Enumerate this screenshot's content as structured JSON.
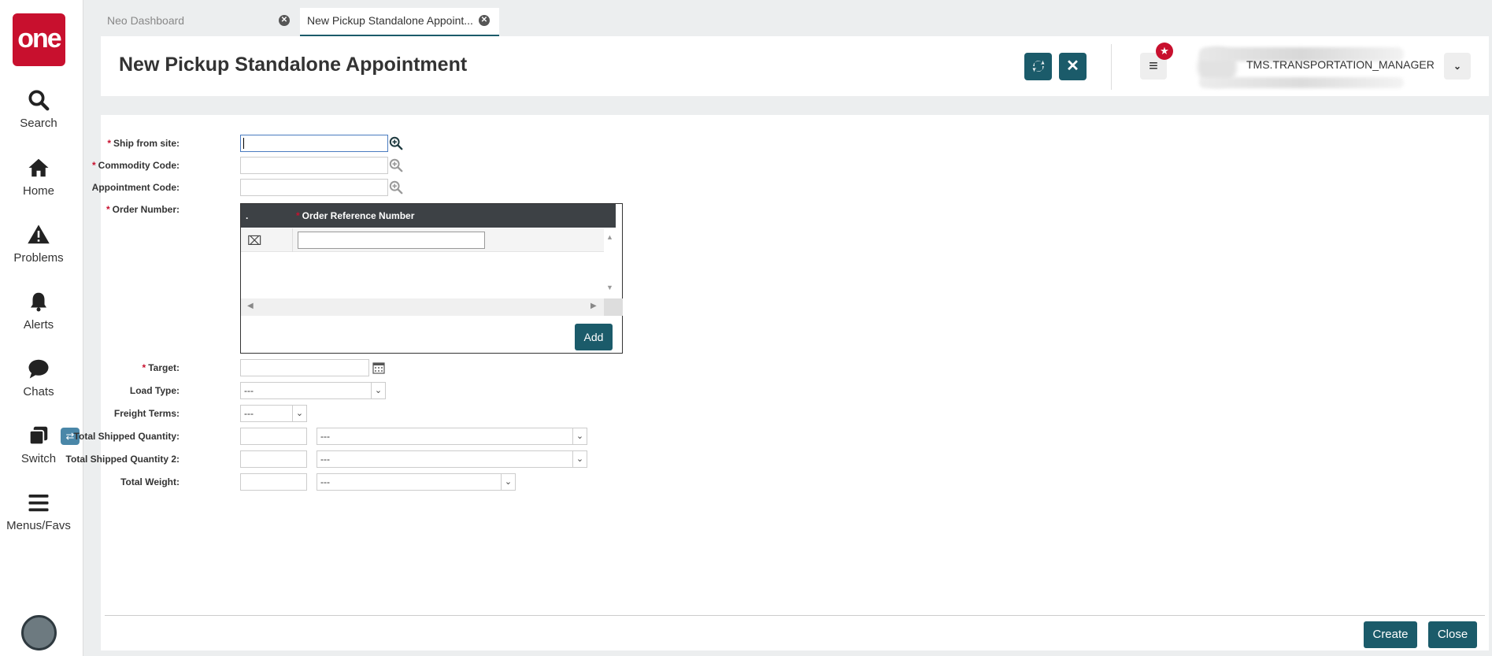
{
  "app": {
    "logo_text": "one",
    "brand_color": "#c8102e",
    "accent_color": "#1b5b6a"
  },
  "nav": {
    "items": [
      {
        "label": "Search",
        "icon": "search-icon"
      },
      {
        "label": "Home",
        "icon": "home-icon"
      },
      {
        "label": "Problems",
        "icon": "warning-icon"
      },
      {
        "label": "Alerts",
        "icon": "bell-icon"
      },
      {
        "label": "Chats",
        "icon": "chat-icon"
      },
      {
        "label": "Switch",
        "icon": "switch-icon"
      },
      {
        "label": "Menus/Favs",
        "icon": "hamburger-icon"
      }
    ]
  },
  "tabs": [
    {
      "label": "Neo Dashboard"
    },
    {
      "label": "New Pickup Standalone Appoint..."
    }
  ],
  "header": {
    "title": "New Pickup Standalone Appointment",
    "user_role": "TMS.TRANSPORTATION_MANAGER"
  },
  "form": {
    "ship_from_site": {
      "label": "Ship from site:",
      "value": ""
    },
    "commodity_code": {
      "label": "Commodity Code:",
      "value": ""
    },
    "appointment_code": {
      "label": "Appointment Code:",
      "value": ""
    },
    "order_number": {
      "label": "Order Number:",
      "col0": ".",
      "col1": "Order Reference Number",
      "rows": [
        {
          "value": ""
        }
      ],
      "add_label": "Add"
    },
    "target": {
      "label": "Target:",
      "value": ""
    },
    "load_type": {
      "label": "Load Type:",
      "value": "---"
    },
    "freight_terms": {
      "label": "Freight Terms:",
      "value": "---"
    },
    "total_shipped_quantity": {
      "label": "Total Shipped Quantity:",
      "value": "",
      "uom": "---"
    },
    "total_shipped_quantity_2": {
      "label": "Total Shipped Quantity 2:",
      "value": "",
      "uom": "---"
    },
    "total_weight": {
      "label": "Total Weight:",
      "value": "",
      "uom": "---"
    }
  },
  "footer": {
    "create_label": "Create",
    "close_label": "Close"
  }
}
